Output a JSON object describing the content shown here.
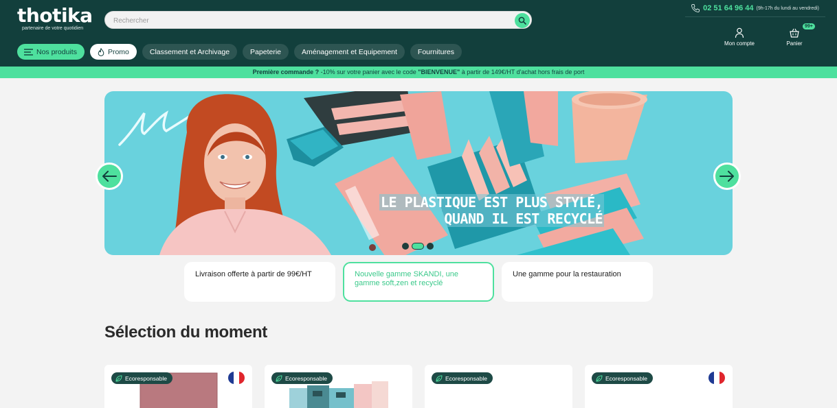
{
  "header": {
    "logo": "thotika",
    "tagline": "partenaire de votre quotidien",
    "search_placeholder": "Rechercher",
    "phone": "02 51 64 96 44",
    "hours": "(9h-17h du lundi au vendredi)",
    "account_label": "Mon compte",
    "cart_label": "Panier",
    "cart_badge": "99+"
  },
  "nav": {
    "items": [
      {
        "label": "Nos produits"
      },
      {
        "label": "Promo"
      },
      {
        "label": "Classement et Archivage"
      },
      {
        "label": "Papeterie"
      },
      {
        "label": "Aménagement et Equipement"
      },
      {
        "label": "Fournitures"
      }
    ]
  },
  "promo_bar": {
    "lead": "Première commande ?",
    "text1": " -10% sur votre panier avec le code ",
    "code": "\"BIENVENUE\"",
    "text2": " à partir de 149€/HT d'achat hors frais de port"
  },
  "hero": {
    "line1": "LE PLASTIQUE EST PLUS STYLÉ,",
    "line2": "QUAND IL EST RECYCLÉ",
    "slide_count": 3,
    "active_slide": 2
  },
  "cards": [
    {
      "label": "Livraison offerte à partir de 99€/HT"
    },
    {
      "label": "Nouvelle gamme SKANDI, une gamme soft,zen et recyclé"
    },
    {
      "label": "Une gamme pour la restauration"
    }
  ],
  "section": {
    "title": "Sélection du moment"
  },
  "products": [
    {
      "badge": "Ecoresponsable",
      "flag": true
    },
    {
      "badge": "Ecoresponsable",
      "flag": false
    },
    {
      "badge": "Ecoresponsable",
      "flag": false
    },
    {
      "badge": "Ecoresponsable",
      "flag": true
    }
  ],
  "colors": {
    "header_bg": "#123f3c",
    "accent": "#4ee09e",
    "hero_bg": "#69d2dd"
  }
}
